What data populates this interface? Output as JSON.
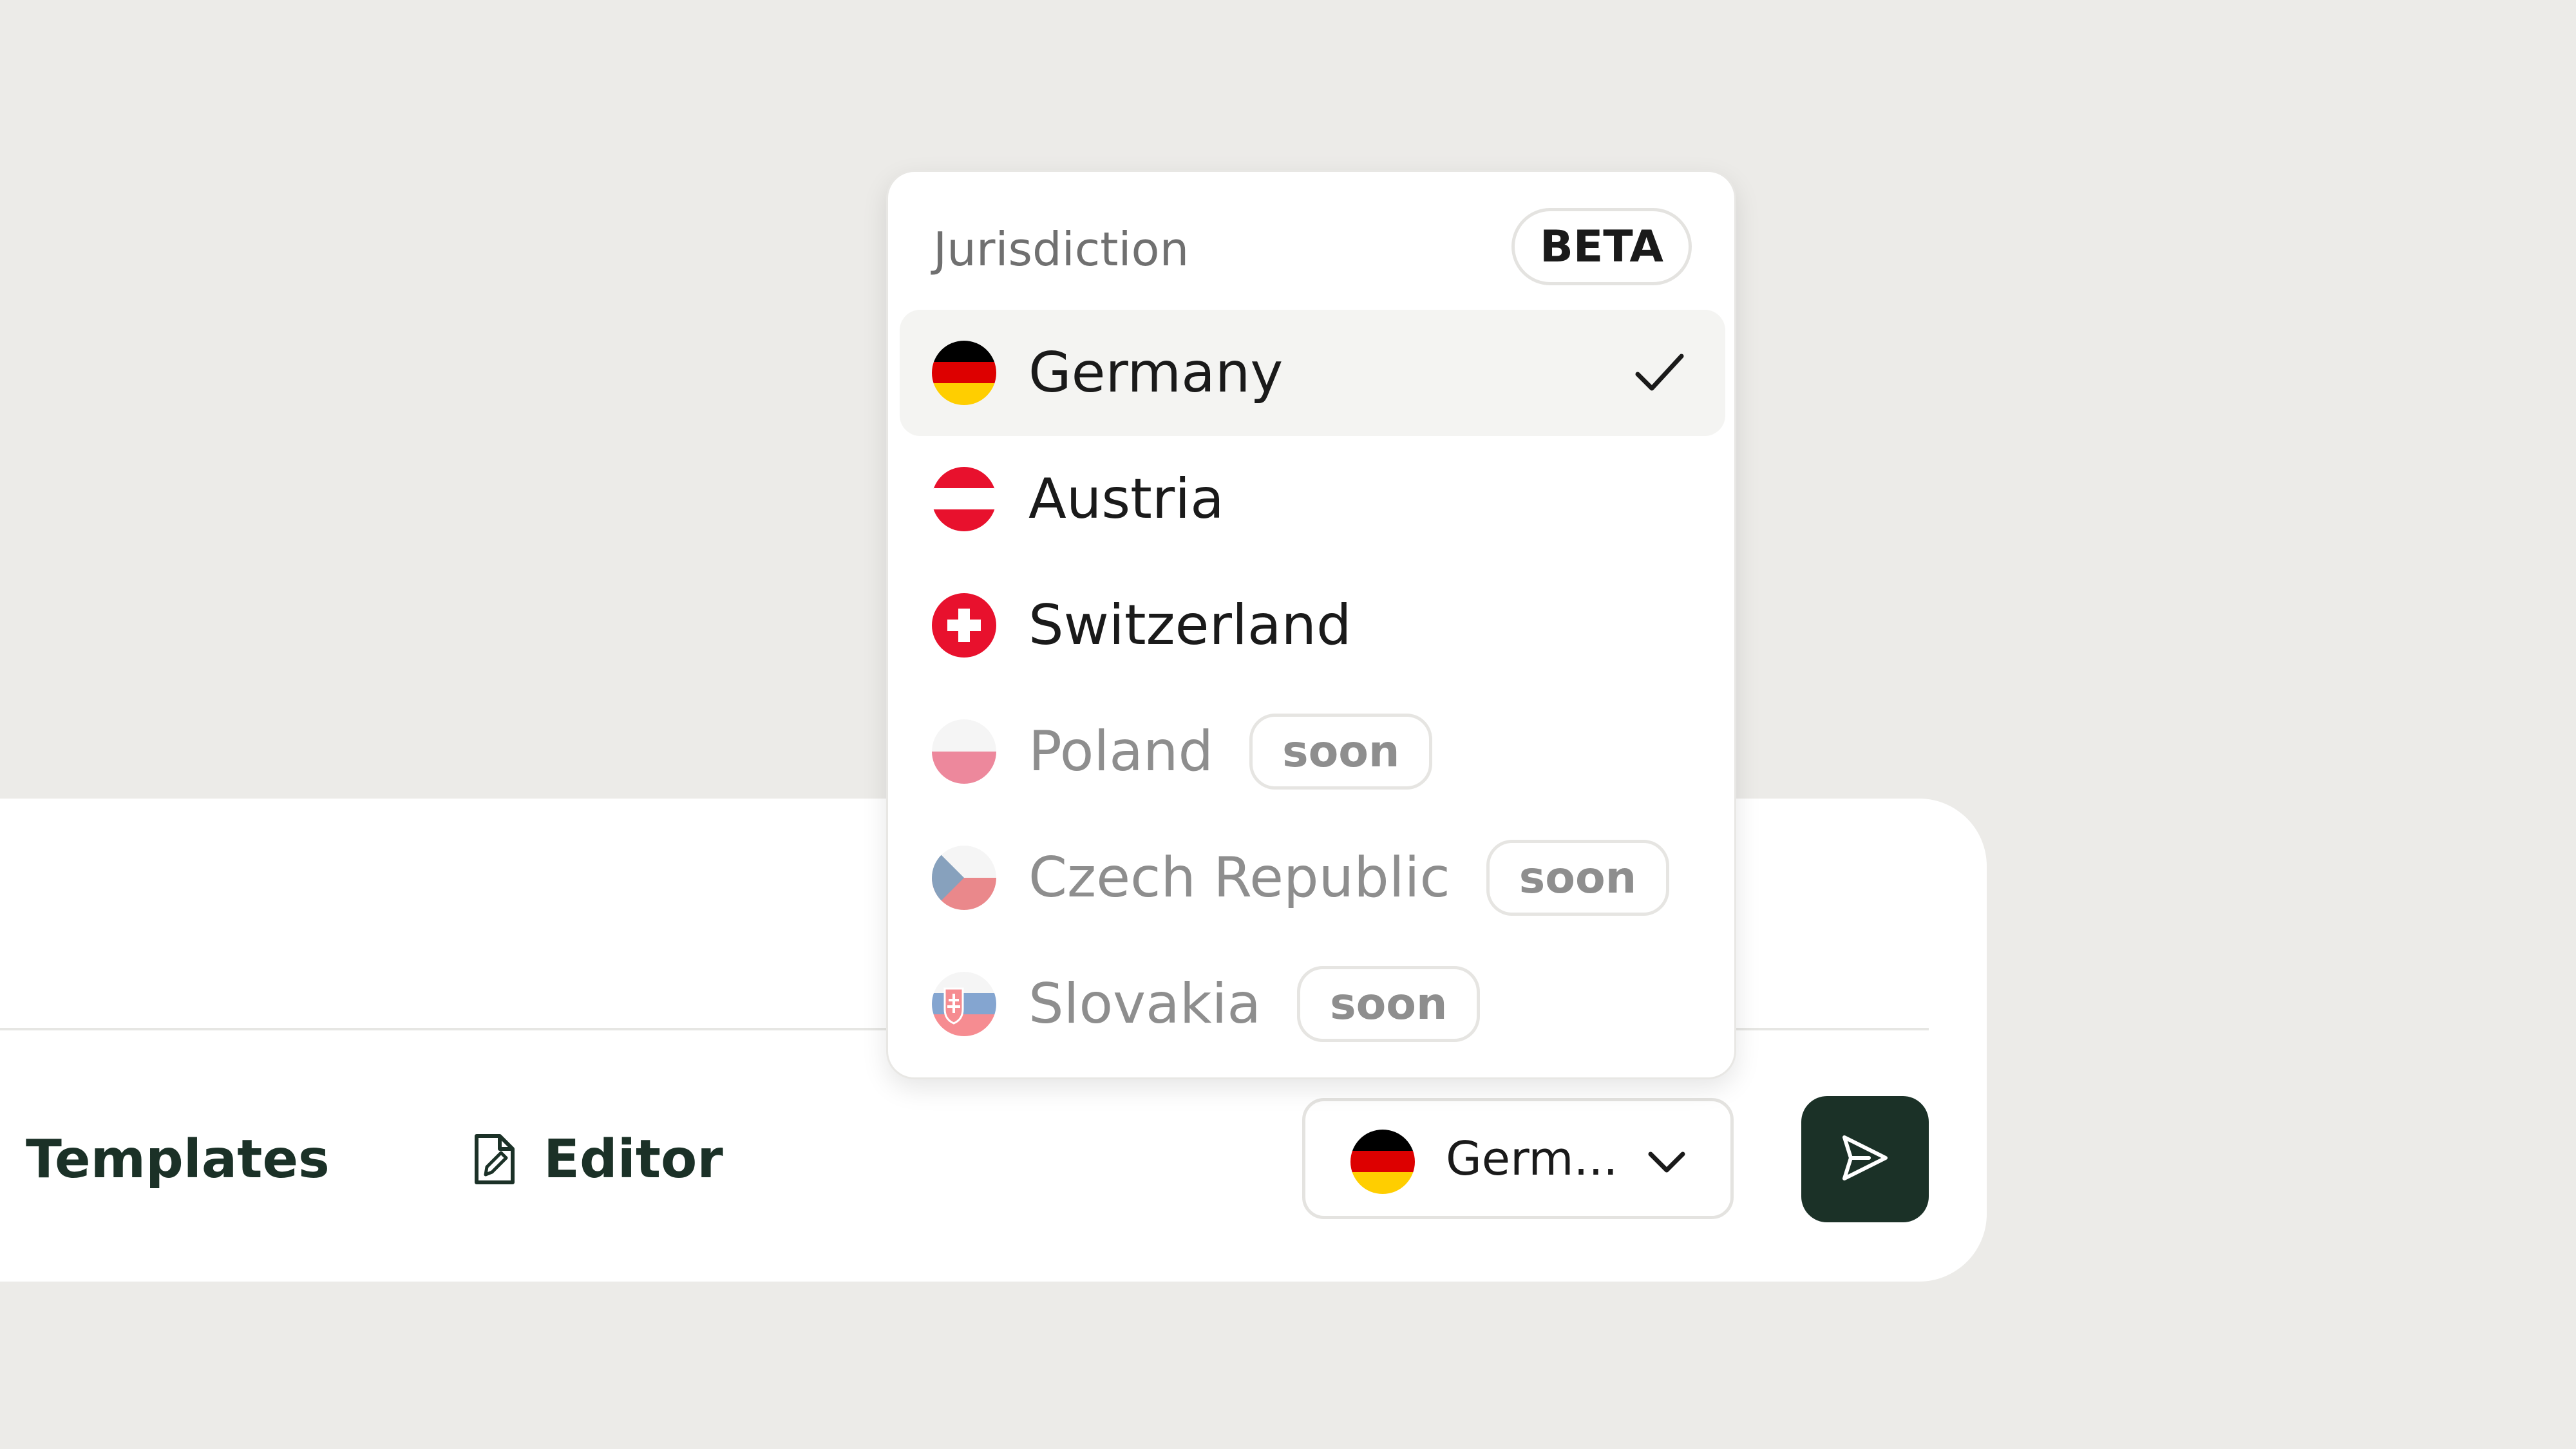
{
  "colors": {
    "background": "#ECEBE8",
    "panel": "#FFFFFF",
    "selected_row": "#F4F4F2",
    "accent_dark_green": "#1B3127",
    "muted_text": "#8E8E8E"
  },
  "composer": {
    "toolbar": {
      "templates_label": "Templates",
      "templates_icon": "bookmark-icon",
      "editor_label": "Editor",
      "editor_icon": "file-edit-icon"
    },
    "jurisdiction_select": {
      "value": "Germ...",
      "flag": "flag-germany-icon",
      "chevron": "chevron-down-icon"
    },
    "send_button": {
      "icon": "send-icon"
    }
  },
  "dropdown": {
    "title": "Jurisdiction",
    "badge": "BETA",
    "options": [
      {
        "name": "Germany",
        "flag": "flag-germany-icon",
        "selected": true,
        "available": true
      },
      {
        "name": "Austria",
        "flag": "flag-austria-icon",
        "selected": false,
        "available": true
      },
      {
        "name": "Switzerland",
        "flag": "flag-switzerland-icon",
        "selected": false,
        "available": true
      },
      {
        "name": "Poland",
        "flag": "flag-poland-icon",
        "selected": false,
        "available": false,
        "badge": "soon"
      },
      {
        "name": "Czech Republic",
        "flag": "flag-czech-republic-icon",
        "selected": false,
        "available": false,
        "badge": "soon"
      },
      {
        "name": "Slovakia",
        "flag": "flag-slovakia-icon",
        "selected": false,
        "available": false,
        "badge": "soon"
      }
    ]
  }
}
